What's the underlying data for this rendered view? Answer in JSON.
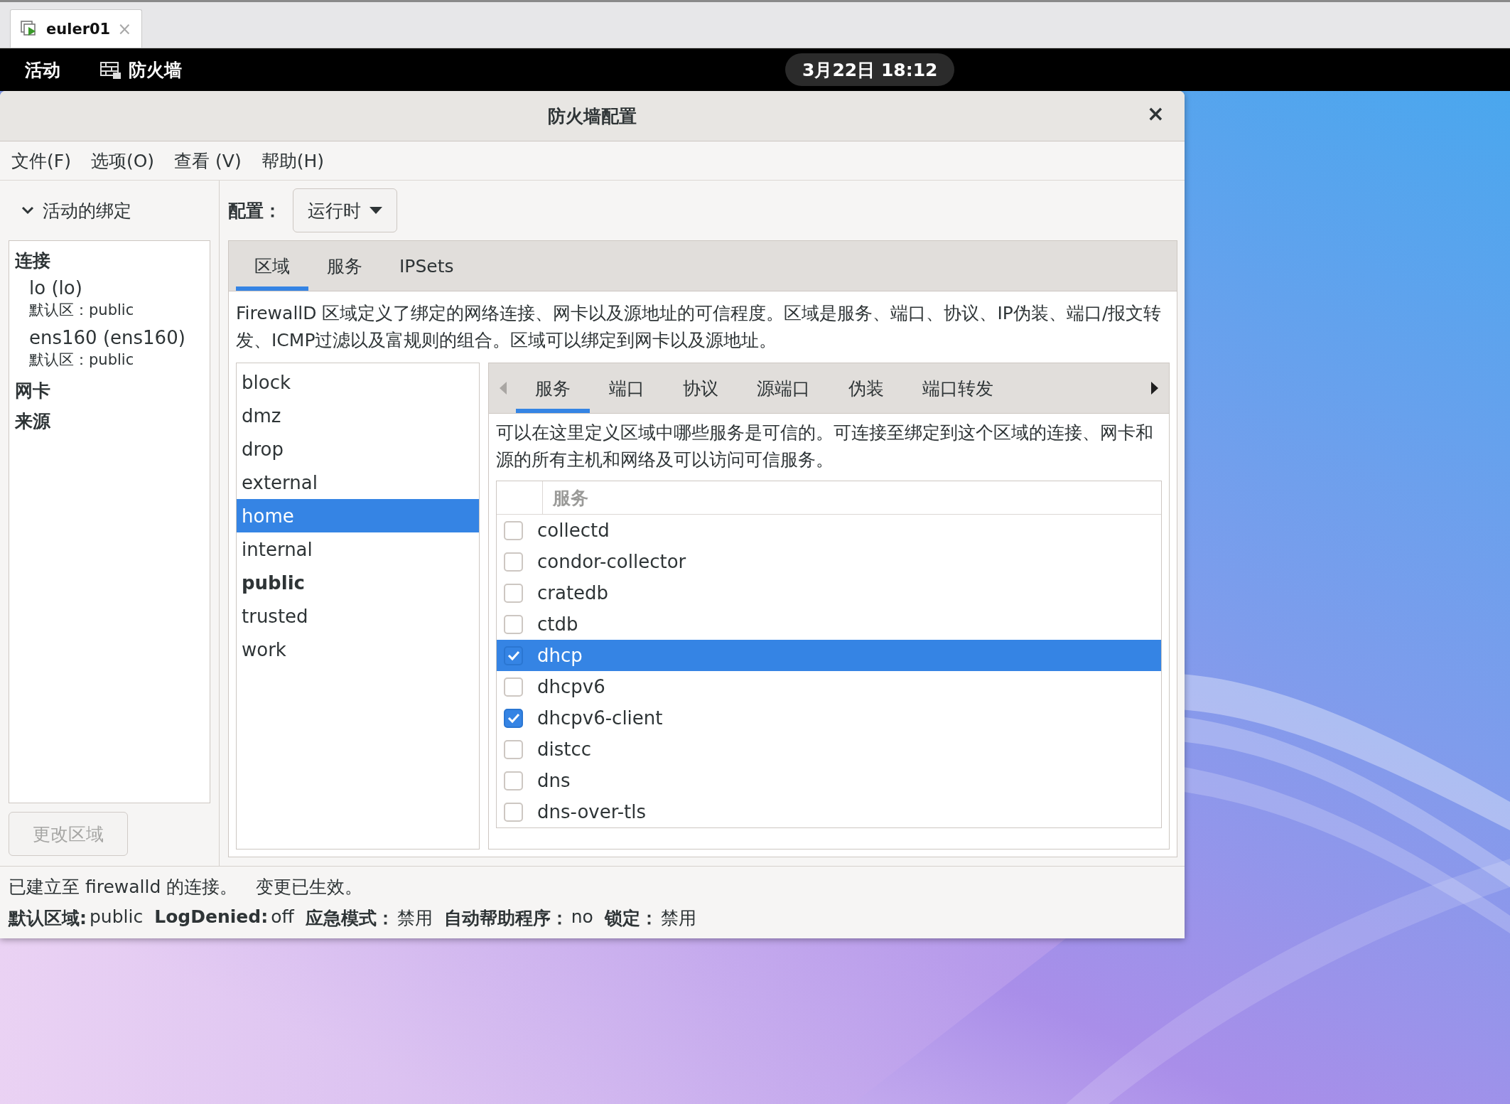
{
  "browser_tab": {
    "label": "euler01",
    "close": "×"
  },
  "top_bar": {
    "activities": "活动",
    "app": "防火墙",
    "clock": "3月22日 18:12"
  },
  "window": {
    "title": "防火墙配置",
    "close": "×"
  },
  "menu": [
    "文件(F)",
    "选项(O)",
    "查看 (V)",
    "帮助(H)"
  ],
  "sidebar": {
    "header": "活动的绑定",
    "expanded": true,
    "groups": [
      {
        "label": "连接",
        "items": [
          {
            "name": "lo (lo)",
            "zone": "默认区：public"
          },
          {
            "name": "ens160 (ens160)",
            "zone": "默认区：public"
          }
        ]
      },
      {
        "label": "网卡"
      },
      {
        "label": "来源"
      }
    ],
    "button": {
      "label": "更改区域",
      "disabled": true
    }
  },
  "config": {
    "label": "配置：",
    "value": "运行时"
  },
  "tabs": [
    {
      "label": "区域",
      "selected": true
    },
    {
      "label": "服务",
      "selected": false
    },
    {
      "label": "IPSets",
      "selected": false
    }
  ],
  "zone_description": "FirewallD 区域定义了绑定的网络连接、网卡以及源地址的可信程度。区域是服务、端口、协议、IP伪装、端口/报文转发、ICMP过滤以及富规则的组合。区域可以绑定到网卡以及源地址。",
  "zones": [
    {
      "name": "block",
      "selected": false,
      "default": false
    },
    {
      "name": "dmz",
      "selected": false,
      "default": false
    },
    {
      "name": "drop",
      "selected": false,
      "default": false
    },
    {
      "name": "external",
      "selected": false,
      "default": false
    },
    {
      "name": "home",
      "selected": true,
      "default": false
    },
    {
      "name": "internal",
      "selected": false,
      "default": false
    },
    {
      "name": "public",
      "selected": false,
      "default": true
    },
    {
      "name": "trusted",
      "selected": false,
      "default": false
    },
    {
      "name": "work",
      "selected": false,
      "default": false
    }
  ],
  "zone_tabs": [
    {
      "label": "服务",
      "selected": true
    },
    {
      "label": "端口",
      "selected": false
    },
    {
      "label": "协议",
      "selected": false
    },
    {
      "label": "源端口",
      "selected": false
    },
    {
      "label": "伪装",
      "selected": false
    },
    {
      "label": "端口转发",
      "selected": false
    }
  ],
  "services_description": "可以在这里定义区域中哪些服务是可信的。可连接至绑定到这个区域的连接、网卡和源的所有主机和网络及可以访问可信服务。",
  "services_column": "服务",
  "services": [
    {
      "name": "collectd",
      "checked": false,
      "selected": false
    },
    {
      "name": "condor-collector",
      "checked": false,
      "selected": false
    },
    {
      "name": "cratedb",
      "checked": false,
      "selected": false
    },
    {
      "name": "ctdb",
      "checked": false,
      "selected": false
    },
    {
      "name": "dhcp",
      "checked": true,
      "selected": true
    },
    {
      "name": "dhcpv6",
      "checked": false,
      "selected": false
    },
    {
      "name": "dhcpv6-client",
      "checked": true,
      "selected": false
    },
    {
      "name": "distcc",
      "checked": false,
      "selected": false
    },
    {
      "name": "dns",
      "checked": false,
      "selected": false
    },
    {
      "name": "dns-over-tls",
      "checked": false,
      "selected": false
    }
  ],
  "status_bar": {
    "messages": [
      "已建立至 firewalld 的连接。",
      "变更已生效。"
    ],
    "items": [
      {
        "label": "默认区域:",
        "value": "public"
      },
      {
        "label": "LogDenied:",
        "value": "off"
      },
      {
        "label": "应急模式：",
        "value": "禁用"
      },
      {
        "label": "自动帮助程序：",
        "value": "no"
      },
      {
        "label": "锁定：",
        "value": "禁用"
      }
    ]
  }
}
